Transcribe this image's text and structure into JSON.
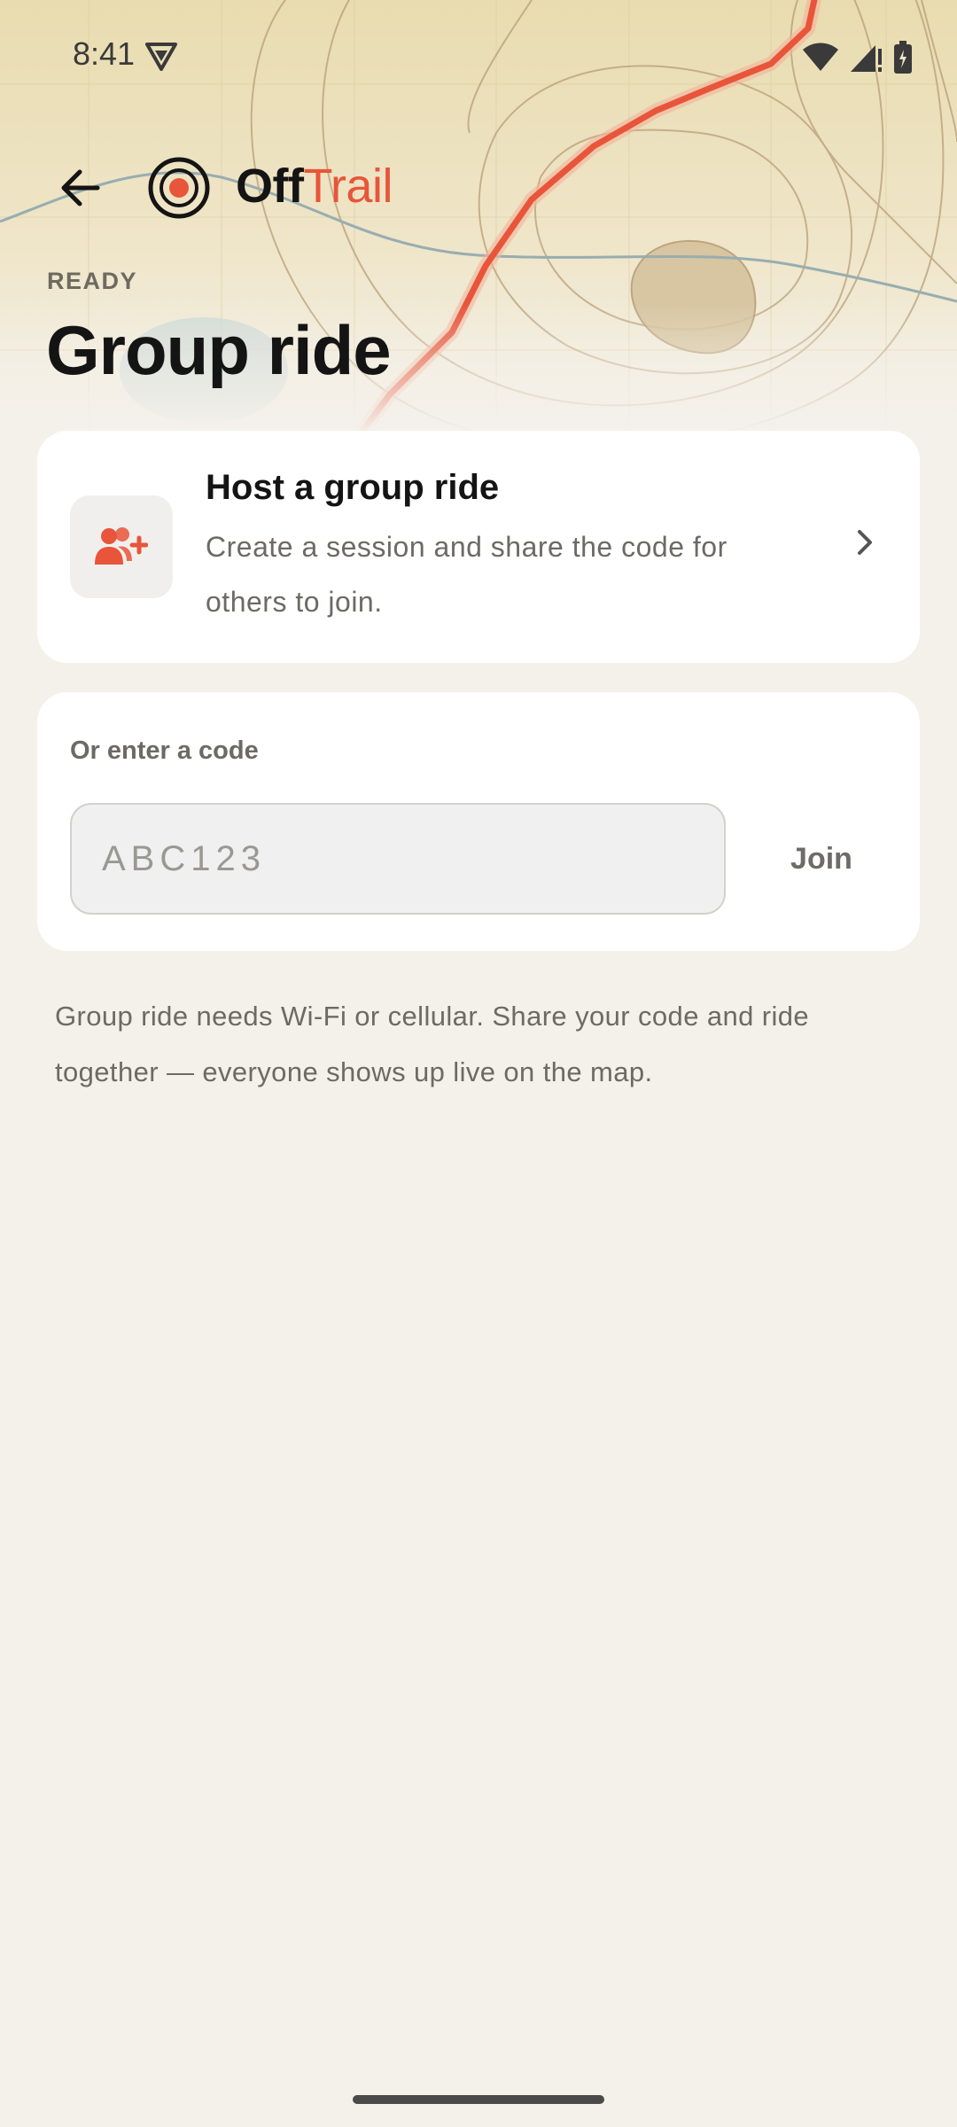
{
  "status_bar": {
    "time": "8:41"
  },
  "app_bar": {
    "brand_part1": "Off",
    "brand_part2": "Trail"
  },
  "header": {
    "overline": "READY",
    "title": "Group ride"
  },
  "host_card": {
    "title": "Host a group ride",
    "description": "Create a session and share the code for others to join."
  },
  "join_card": {
    "label": "Or enter a code",
    "input_placeholder": "ABC123",
    "input_value": "",
    "join_label": "Join"
  },
  "note": "Group ride needs Wi-Fi or cellular. Share your code and ride together — everyone shows up live on the map.",
  "colors": {
    "accent": "#e8553a",
    "background": "#f4f1ea",
    "hero_top": "#e9dcb0",
    "card": "#ffffff"
  },
  "icons": [
    "back-arrow-icon",
    "logo-target-icon",
    "add-person-icon",
    "chevron-right-icon",
    "wifi-icon",
    "cell-signal-icon",
    "battery-icon",
    "shield-icon"
  ]
}
